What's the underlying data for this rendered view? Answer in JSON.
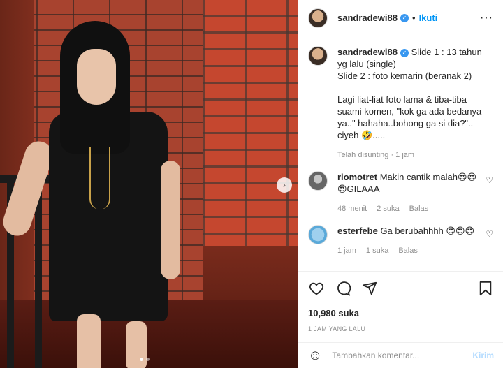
{
  "post": {
    "username": "sandradewi88",
    "follow_label": "Ikuti",
    "separator": "•",
    "more_icon": "more-horizontal-icon"
  },
  "caption": {
    "username": "sandradewi88",
    "text": "Slide 1 : 13 tahun yg lalu (single)\nSlide 2 : foto kemarin (beranak 2)\n\nLagi liat-liat foto lama & tiba-tiba suami komen, \"kok ga ada bedanya ya..\" hahaha..bohong ga si dia?\".. ciyeh 🤣.....",
    "edited_label": "Telah disunting",
    "time": "1 jam"
  },
  "comments": [
    {
      "username": "riomotret",
      "text": "Makin cantik malah😍😍😍GILAAA",
      "time": "48 menit",
      "likes": "2 suka",
      "reply": "Balas"
    },
    {
      "username": "esterfebe",
      "text": "Ga berubahhhh 😍😍😍",
      "time": "1 jam",
      "likes": "1 suka",
      "reply": "Balas"
    }
  ],
  "actions": {
    "likes": "10,980 suka",
    "timestamp": "1 JAM YANG LALU"
  },
  "add_comment": {
    "placeholder": "Tambahkan komentar...",
    "post_label": "Kirim"
  },
  "carousel": {
    "slide_count": 2,
    "active_slide": 1
  },
  "colors": {
    "accent": "#0095f6",
    "verified": "#3897f0",
    "muted": "#8e8e8e"
  }
}
